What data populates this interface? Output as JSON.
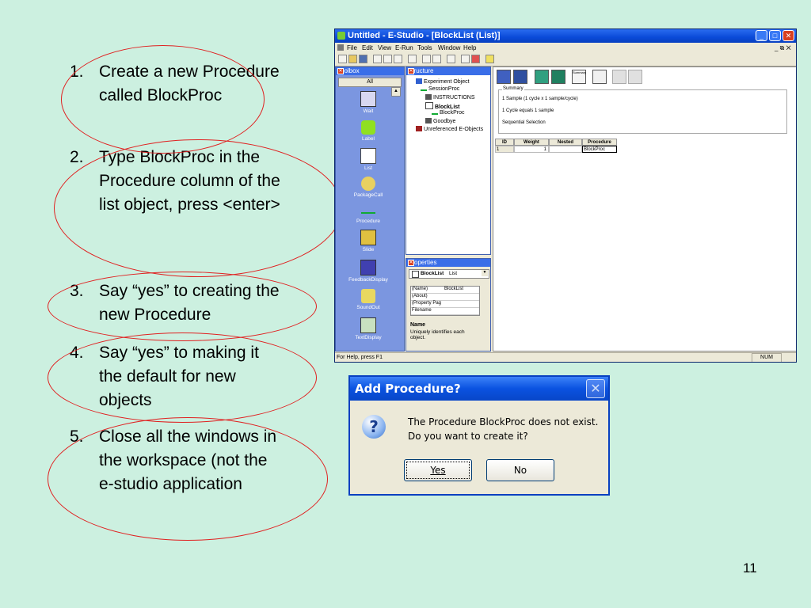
{
  "steps": [
    {
      "num": "1.",
      "text": "Create a new Procedure called BlockProc"
    },
    {
      "num": "2.",
      "text": "Type BlockProc in the Procedure column of the list object, press <enter>"
    },
    {
      "num": "3.",
      "text": "Say “yes” to creating the new Procedure"
    },
    {
      "num": "4.",
      "text": "Say “yes” to making it the default for new objects"
    },
    {
      "num": "5.",
      "text": "Close all the windows in the workspace (not the e-studio application"
    }
  ],
  "slide_number": "11",
  "window": {
    "title": "Untitled - E-Studio - [BlockList  (List)]",
    "menu": [
      "File",
      "Edit",
      "View",
      "E-Run",
      "Tools",
      "Window",
      "Help"
    ],
    "status_left": "For Help, press F1",
    "status_right": "NUM"
  },
  "toolbox": {
    "title": "Toolbox",
    "filter": "All",
    "tools": [
      "Wait",
      "Label",
      "List",
      "PackageCall",
      "Procedure",
      "Slide",
      "FeedbackDisplay",
      "SoundOut",
      "TextDisplay"
    ]
  },
  "structure": {
    "title": "Structure",
    "nodes": [
      "Experiment Object",
      "SessionProc",
      "INSTRUCTIONS",
      "BlockList",
      "BlockProc",
      "Goodbye",
      "Unreferenced E-Objects"
    ]
  },
  "properties": {
    "title": "Properties",
    "object_name": "BlockList",
    "object_type": "List",
    "rows": [
      {
        "name": "(Name)",
        "value": "BlockList"
      },
      {
        "name": "(About)",
        "value": ""
      },
      {
        "name": "(Property Pag",
        "value": ""
      },
      {
        "name": "Filename",
        "value": ""
      }
    ],
    "help_title": "Name",
    "help_text": "Uniquely identifies each object."
  },
  "list_editor": {
    "summary_label": "Summary",
    "summary_lines": [
      "1 Sample (1 cycle x 1 sample/cycle)",
      "1 Cycle equals 1 sample",
      "Sequential Selection"
    ],
    "columns": [
      "ID",
      "Weight",
      "Nested",
      "Procedure"
    ],
    "row": {
      "id": "1",
      "weight": "1",
      "nested": "",
      "procedure": "BlockProc"
    },
    "summary_btn": "Summary"
  },
  "dialog": {
    "title": "Add Procedure?",
    "message_line1": "The Procedure BlockProc does not exist.",
    "message_line2": "Do you want to create it?",
    "yes": "Yes",
    "no": "No",
    "close": "✕",
    "icon": "?"
  }
}
